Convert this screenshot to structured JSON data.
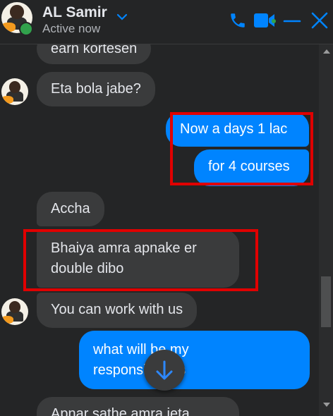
{
  "header": {
    "name": "AL Samir",
    "status": "Active now",
    "icons": [
      "chevron-down-icon",
      "phone-icon",
      "video-icon",
      "minimize-icon",
      "close-icon"
    ],
    "accent_color": "#0084ff",
    "online_color": "#31a24c"
  },
  "messages": [
    {
      "from": "contact",
      "text": "earn kortesen"
    },
    {
      "from": "contact",
      "text": "Eta bola jabe?"
    },
    {
      "from": "me",
      "text": "Now a days 1 lac"
    },
    {
      "from": "me",
      "text": "for 4 courses"
    },
    {
      "from": "contact",
      "text": "Accha"
    },
    {
      "from": "contact",
      "lines": [
        "Bhaiya amra apnake er",
        "double dibo"
      ]
    },
    {
      "from": "contact",
      "text": "You can work with us"
    },
    {
      "from": "me",
      "lines": [
        "what will be my",
        "responsibilities"
      ]
    },
    {
      "from": "contact",
      "text": "Apnar sathe amra jeta"
    }
  ],
  "colors": {
    "background": "#242526",
    "incoming_bubble": "#3a3b3c",
    "outgoing_bubble": "#0084ff",
    "highlight": "#e00000"
  },
  "jump_button": {
    "icon": "arrow-down-icon"
  }
}
